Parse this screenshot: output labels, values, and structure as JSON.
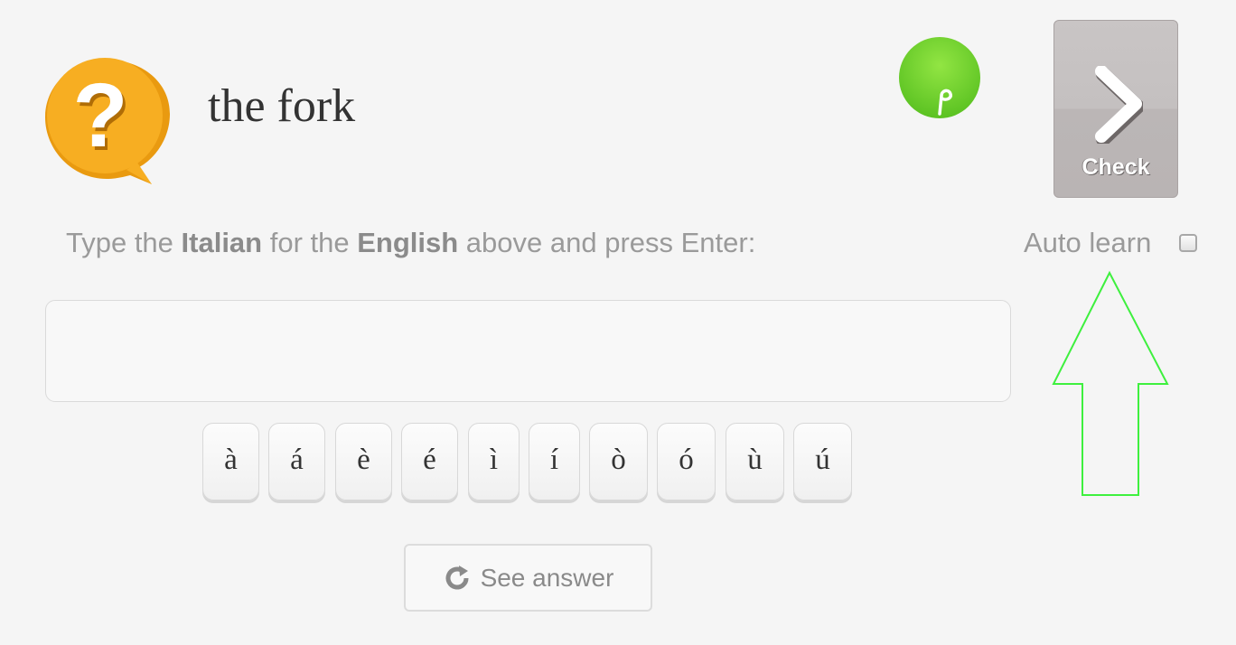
{
  "prompt": {
    "word": "the fork",
    "question_icon": "question-speech-bubble-icon"
  },
  "seed_icon": "seed-sprout-icon",
  "check_button": {
    "label": "Check",
    "icon": "chevron-right-icon"
  },
  "instruction": {
    "part1": "Type the ",
    "lang_target": "Italian",
    "part2": " for the ",
    "lang_source": "English",
    "part3": " above and press Enter:"
  },
  "auto_learn": {
    "label": "Auto learn",
    "checked": false
  },
  "answer_input": {
    "value": "",
    "placeholder": ""
  },
  "accent_keys": [
    "à",
    "á",
    "è",
    "é",
    "ì",
    "í",
    "ò",
    "ó",
    "ù",
    "ú"
  ],
  "see_answer": {
    "label": "See answer",
    "icon": "refresh-icon"
  },
  "annotation": {
    "icon": "up-arrow-annotation",
    "color": "#3ef03e"
  },
  "colors": {
    "question_orange": "#f5a51a",
    "seed_green": "#6fce2f",
    "check_gray": "#c4c0c0"
  }
}
